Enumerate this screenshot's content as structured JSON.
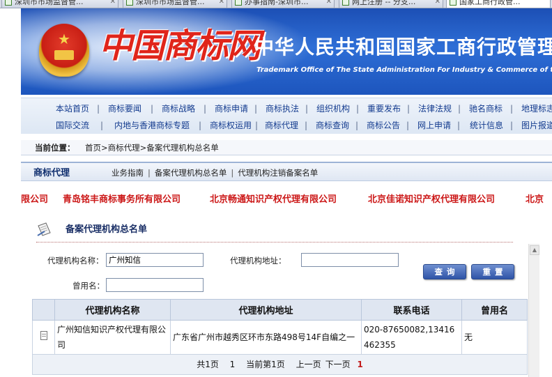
{
  "browser": {
    "tabs": [
      {
        "label": "深圳市市场监督管..."
      },
      {
        "label": "深圳市市场监督管..."
      },
      {
        "label": "办事指南-深圳市..."
      },
      {
        "label": "网上注册 -- 分支..."
      },
      {
        "label": "国家工商行政管..."
      }
    ]
  },
  "header": {
    "logo_text": "中国商标网",
    "site_title": "中华人民共和国国家工商行政管理",
    "site_subtitle": "Trademark Office of The State Administration For Industry & Commerce of th"
  },
  "nav": {
    "row1": [
      "本站首页",
      "商标要闻",
      "商标战略",
      "商标申请",
      "商标执法",
      "组织机构",
      "重要发布",
      "法律法规",
      "驰名商标",
      "地理标志"
    ],
    "row2": [
      "国际交流",
      "内地与香港商标专题",
      "商标权运用",
      "商标代理",
      "商标查询",
      "商标公告",
      "网上申请",
      "统计信息",
      "图片报道"
    ]
  },
  "breadcrumb": {
    "label": "当前位置：",
    "path": "首页>商标代理>备案代理机构总名单"
  },
  "section": {
    "title": "商标代理",
    "links": [
      "业务指南",
      "备案代理机构总名单",
      "代理机构注销备案名单"
    ]
  },
  "marquee": {
    "items": [
      "限公司",
      "青岛铭丰商标事务所有限公司",
      "北京畅通知识产权代理有限公司",
      "北京佳诺知识产权代理有限公司",
      "北京"
    ]
  },
  "panel": {
    "title": "备案代理机构总名单"
  },
  "search": {
    "name_label": "代理机构名称：",
    "name_value": "广州知信",
    "address_label": "代理机构地址：",
    "address_value": "",
    "former_label": "曾用名：",
    "former_value": "",
    "query_button": "查询",
    "reset_button": "重置"
  },
  "table": {
    "headers": [
      "代理机构名称",
      "代理机构地址",
      "联系电话",
      "曾用名"
    ],
    "rows": [
      {
        "name": "广州知信知识产权代理有限公司",
        "address": "广东省广州市越秀区环市东路498号14F自编之一",
        "phone": "020-87650082,13416462355",
        "former_name": "无"
      }
    ]
  },
  "pager": {
    "total": "共1页",
    "count": "1",
    "current": "当前第1页",
    "prev": "上一页",
    "next": "下一页",
    "page": "1"
  },
  "colors": {
    "banner_blue": "#2e6ed6",
    "nav_link": "#123a8e",
    "marquee_red": "#cc1818",
    "button_blue": "#2f54a8"
  }
}
